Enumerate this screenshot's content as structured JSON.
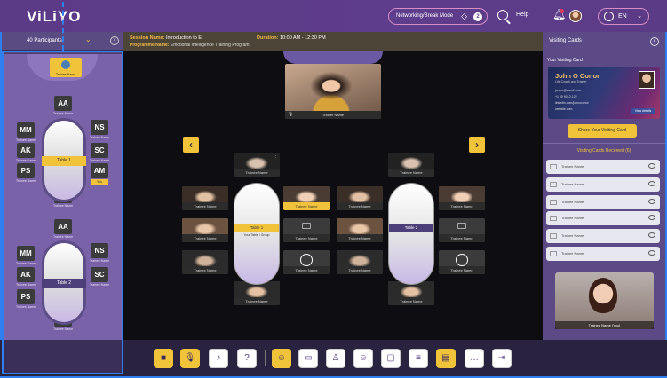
{
  "app": {
    "logo": "ViLiYO"
  },
  "topbar": {
    "mode_label": "Networking/Break Mode",
    "mode_count": "2",
    "help_label": "Help",
    "language": "EN"
  },
  "left_panel": {
    "title": "40 Participants",
    "host_label": "Trainee Name",
    "table1": {
      "name": "Table 1",
      "seats": [
        {
          "initials": "AA",
          "name": "Trainee Name"
        },
        {
          "initials": "MM",
          "name": "Trainee Name"
        },
        {
          "initials": "NS",
          "name": "Trainee Name"
        },
        {
          "initials": "AK",
          "name": "Trainee Name"
        },
        {
          "initials": "SC",
          "name": "Trainee Name"
        },
        {
          "initials": "PS",
          "name": "Trainee Name"
        },
        {
          "initials": "AM",
          "name": "You"
        },
        {
          "initials": "MC",
          "name": "Trainee Name"
        }
      ]
    },
    "table2": {
      "name": "Table 2",
      "seats": [
        {
          "initials": "AA",
          "name": "Trainee Name"
        },
        {
          "initials": "MM",
          "name": "Trainee Name"
        },
        {
          "initials": "NS",
          "name": "Trainee Name"
        },
        {
          "initials": "AK",
          "name": "Trainee Name"
        },
        {
          "initials": "SC",
          "name": "Trainee Name"
        },
        {
          "initials": "PS",
          "name": "Trainee Name"
        },
        {
          "initials": "MC",
          "name": "Trainee Name"
        }
      ]
    }
  },
  "session": {
    "name_label": "Session Name:",
    "name_value": "Introduction to EI",
    "program_label": "Programme Name:",
    "program_value": "Emotional Intelligence Training Program",
    "duration_label": "Duration:",
    "duration_value": "10:00 AM - 12:30 PM"
  },
  "stage": {
    "trainer_name": "Trainer Name",
    "table1_label": "Table 1",
    "table1_sub": "Your Table / Group",
    "table2_label": "Table 2",
    "tile_name": "Trainee Name"
  },
  "right_panel": {
    "title": "Visiting Cards",
    "your_card_label": "Your Visiting Card",
    "card": {
      "name": "John O Conor",
      "role": "Life Coach and Trainer",
      "email": "jconor@email.com",
      "phone": "+1 00 9012-122",
      "linkedin": "linkedin.com/johnoconor",
      "website": "website.com",
      "view_label": "View details"
    },
    "share_label": "Share Your Visiting Card",
    "received_title": "Visiting Cards Received (6)",
    "received": [
      "Trainee Name",
      "Trainee Name",
      "Trainee Name",
      "Trainee Name",
      "Trainee Name",
      "Trainee Name"
    ],
    "self_name": "Trainee Name (You)"
  },
  "toolbar": {
    "icons": [
      "camera-icon",
      "mic-icon",
      "speaker-icon",
      "help-icon",
      "participants-icon",
      "whiteboard-icon",
      "trainer-icon",
      "emoji-icon",
      "chat-icon",
      "notes-icon",
      "visiting-card-icon",
      "more-icon",
      "leave-icon"
    ]
  },
  "colors": {
    "accent": "#f1c33b",
    "brand": "#5b3a86",
    "selection": "#2f7ff0"
  }
}
